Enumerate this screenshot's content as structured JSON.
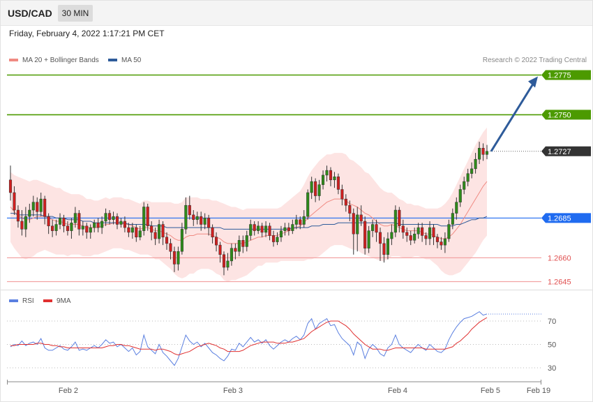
{
  "header": {
    "symbol": "USD/CAD",
    "timeframe": "30 MIN"
  },
  "datetime": "Friday, February 4, 2022 1:17:21 PM CET",
  "legend": {
    "ma20": {
      "label": "MA 20 + Bollinger Bands",
      "color": "#f08a82"
    },
    "ma50": {
      "label": "MA 50",
      "color": "#2e5b9a"
    }
  },
  "credit": "Research © 2022 Trading Central",
  "rsi_legend": {
    "rsi": {
      "label": "RSI",
      "color": "#5a7fe0"
    },
    "ma9": {
      "label": "9MA",
      "color": "#e03030"
    }
  },
  "chart_data": {
    "type": "candlestick",
    "x_labels": [
      "Feb 2",
      "Feb 3",
      "Feb 4",
      "Feb 5",
      "Feb 19"
    ],
    "y_range": [
      1.2628,
      1.2795
    ],
    "current_price": {
      "value": "1.2727",
      "color": "#333333"
    },
    "targets": [
      {
        "value": "1.2775",
        "color": "#4c9a00"
      },
      {
        "value": "1.2750",
        "color": "#4c9a00"
      }
    ],
    "pivot": {
      "value": "1.2685",
      "color": "#1f6bf0"
    },
    "supports": [
      {
        "value": "1.2660",
        "color": "#e05050"
      },
      {
        "value": "1.2645",
        "color": "#e05050"
      }
    ],
    "projection": {
      "from": 1.2727,
      "to": 1.2775,
      "color": "#2e5b9a"
    },
    "candles": [
      [
        1.2709,
        1.2701,
        1.2718,
        1.2696
      ],
      [
        1.2701,
        1.269,
        1.2705,
        1.2687
      ],
      [
        1.269,
        1.2683,
        1.2693,
        1.2679
      ],
      [
        1.2683,
        1.2678,
        1.269,
        1.2674
      ],
      [
        1.2678,
        1.2686,
        1.2692,
        1.2673
      ],
      [
        1.2686,
        1.269,
        1.2694,
        1.2682
      ],
      [
        1.269,
        1.2695,
        1.2699,
        1.2686
      ],
      [
        1.2695,
        1.2689,
        1.2698,
        1.2684
      ],
      [
        1.2689,
        1.2697,
        1.2701,
        1.2686
      ],
      [
        1.2697,
        1.2686,
        1.2699,
        1.2681
      ],
      [
        1.2686,
        1.268,
        1.2688,
        1.2675
      ],
      [
        1.268,
        1.2677,
        1.2684,
        1.2673
      ],
      [
        1.2677,
        1.2681,
        1.2684,
        1.2674
      ],
      [
        1.2681,
        1.2685,
        1.2688,
        1.2678
      ],
      [
        1.2685,
        1.268,
        1.2687,
        1.2676
      ],
      [
        1.268,
        1.2677,
        1.2683,
        1.2674
      ],
      [
        1.2677,
        1.2682,
        1.2685,
        1.2672
      ],
      [
        1.2682,
        1.2688,
        1.2692,
        1.2679
      ],
      [
        1.2688,
        1.2678,
        1.269,
        1.2674
      ],
      [
        1.2678,
        1.268,
        1.2683,
        1.2674
      ],
      [
        1.268,
        1.2676,
        1.2682,
        1.2672
      ],
      [
        1.2676,
        1.2679,
        1.2681,
        1.2672
      ],
      [
        1.2679,
        1.2682,
        1.2684,
        1.2676
      ],
      [
        1.2682,
        1.2679,
        1.2685,
        1.2676
      ],
      [
        1.2679,
        1.2683,
        1.2686,
        1.2675
      ],
      [
        1.2683,
        1.2688,
        1.2691,
        1.268
      ],
      [
        1.2688,
        1.2684,
        1.269,
        1.2681
      ],
      [
        1.2684,
        1.2686,
        1.2689,
        1.2681
      ],
      [
        1.2686,
        1.2681,
        1.2688,
        1.2678
      ],
      [
        1.2681,
        1.2683,
        1.2685,
        1.2679
      ],
      [
        1.2683,
        1.2679,
        1.2686,
        1.2676
      ],
      [
        1.2679,
        1.2676,
        1.2682,
        1.2673
      ],
      [
        1.2676,
        1.2679,
        1.2682,
        1.2672
      ],
      [
        1.2679,
        1.2673,
        1.2681,
        1.267
      ],
      [
        1.2673,
        1.2677,
        1.268,
        1.2671
      ],
      [
        1.2677,
        1.2692,
        1.2695,
        1.2674
      ],
      [
        1.2692,
        1.268,
        1.2694,
        1.2677
      ],
      [
        1.268,
        1.2676,
        1.2683,
        1.2671
      ],
      [
        1.2676,
        1.2672,
        1.2679,
        1.2668
      ],
      [
        1.2672,
        1.2681,
        1.2684,
        1.2669
      ],
      [
        1.2681,
        1.2673,
        1.2683,
        1.2668
      ],
      [
        1.2673,
        1.2669,
        1.2676,
        1.2665
      ],
      [
        1.2669,
        1.2664,
        1.2672,
        1.2659
      ],
      [
        1.2664,
        1.2656,
        1.2667,
        1.2651
      ],
      [
        1.2656,
        1.2664,
        1.2667,
        1.2652
      ],
      [
        1.2664,
        1.2678,
        1.2682,
        1.2662
      ],
      [
        1.2678,
        1.2693,
        1.2698,
        1.2675
      ],
      [
        1.2693,
        1.2687,
        1.2699,
        1.2684
      ],
      [
        1.2687,
        1.2684,
        1.269,
        1.268
      ],
      [
        1.2684,
        1.2686,
        1.2689,
        1.2681
      ],
      [
        1.2686,
        1.2681,
        1.2689,
        1.2677
      ],
      [
        1.2681,
        1.2685,
        1.2688,
        1.2678
      ],
      [
        1.2685,
        1.2679,
        1.2687,
        1.2674
      ],
      [
        1.2679,
        1.2673,
        1.2681,
        1.2669
      ],
      [
        1.2673,
        1.2668,
        1.2676,
        1.2664
      ],
      [
        1.2668,
        1.2662,
        1.267,
        1.2657
      ],
      [
        1.2662,
        1.2654,
        1.2664,
        1.2649
      ],
      [
        1.2654,
        1.2658,
        1.2663,
        1.2652
      ],
      [
        1.2658,
        1.2666,
        1.2669,
        1.2655
      ],
      [
        1.2666,
        1.2664,
        1.2669,
        1.2659
      ],
      [
        1.2664,
        1.2671,
        1.2674,
        1.2661
      ],
      [
        1.2671,
        1.2667,
        1.2674,
        1.2663
      ],
      [
        1.2667,
        1.2674,
        1.2677,
        1.2664
      ],
      [
        1.2674,
        1.2681,
        1.2684,
        1.2671
      ],
      [
        1.2681,
        1.2677,
        1.2683,
        1.2674
      ],
      [
        1.2677,
        1.268,
        1.2683,
        1.2675
      ],
      [
        1.268,
        1.2676,
        1.2682,
        1.2673
      ],
      [
        1.2676,
        1.268,
        1.2683,
        1.2673
      ],
      [
        1.268,
        1.2674,
        1.2682,
        1.2671
      ],
      [
        1.2674,
        1.267,
        1.2677,
        1.2667
      ],
      [
        1.267,
        1.2673,
        1.2676,
        1.2668
      ],
      [
        1.2673,
        1.2677,
        1.268,
        1.267
      ],
      [
        1.2677,
        1.2679,
        1.2682,
        1.2674
      ],
      [
        1.2679,
        1.2677,
        1.2682,
        1.2674
      ],
      [
        1.2677,
        1.2681,
        1.2684,
        1.2675
      ],
      [
        1.2681,
        1.2684,
        1.2687,
        1.2678
      ],
      [
        1.2684,
        1.2681,
        1.2686,
        1.2678
      ],
      [
        1.2681,
        1.2686,
        1.269,
        1.2679
      ],
      [
        1.2686,
        1.2701,
        1.2703,
        1.2684
      ],
      [
        1.2701,
        1.2708,
        1.2711,
        1.2697
      ],
      [
        1.2708,
        1.2699,
        1.271,
        1.2695
      ],
      [
        1.2699,
        1.2706,
        1.2709,
        1.2696
      ],
      [
        1.2706,
        1.2712,
        1.2715,
        1.2703
      ],
      [
        1.2712,
        1.2715,
        1.2718,
        1.2708
      ],
      [
        1.2715,
        1.2709,
        1.2717,
        1.2705
      ],
      [
        1.2709,
        1.2711,
        1.2714,
        1.2704
      ],
      [
        1.2711,
        1.2703,
        1.2713,
        1.27
      ],
      [
        1.2703,
        1.2697,
        1.2706,
        1.2693
      ],
      [
        1.2697,
        1.2693,
        1.27,
        1.2689
      ],
      [
        1.2693,
        1.2688,
        1.2696,
        1.2683
      ],
      [
        1.2688,
        1.2675,
        1.2691,
        1.2662
      ],
      [
        1.2675,
        1.2687,
        1.2692,
        1.2664
      ],
      [
        1.2687,
        1.2683,
        1.2693,
        1.268
      ],
      [
        1.2683,
        1.2666,
        1.2686,
        1.2662
      ],
      [
        1.2666,
        1.2677,
        1.268,
        1.2663
      ],
      [
        1.2677,
        1.2681,
        1.2684,
        1.2673
      ],
      [
        1.2681,
        1.2676,
        1.2684,
        1.267
      ],
      [
        1.2676,
        1.2669,
        1.2679,
        1.2658
      ],
      [
        1.2669,
        1.2662,
        1.2673,
        1.2657
      ],
      [
        1.2662,
        1.2672,
        1.2676,
        1.2659
      ],
      [
        1.2672,
        1.2676,
        1.2681,
        1.2668
      ],
      [
        1.2676,
        1.269,
        1.2693,
        1.2673
      ],
      [
        1.269,
        1.268,
        1.2692,
        1.2676
      ],
      [
        1.268,
        1.2676,
        1.2684,
        1.2672
      ],
      [
        1.2676,
        1.2674,
        1.2679,
        1.267
      ],
      [
        1.2674,
        1.2671,
        1.2677,
        1.2668
      ],
      [
        1.2671,
        1.2675,
        1.2679,
        1.2669
      ],
      [
        1.2675,
        1.2679,
        1.2682,
        1.2672
      ],
      [
        1.2679,
        1.2674,
        1.2682,
        1.267
      ],
      [
        1.2674,
        1.2672,
        1.2676,
        1.2668
      ],
      [
        1.2672,
        1.2679,
        1.2683,
        1.2668
      ],
      [
        1.2679,
        1.2673,
        1.2681,
        1.2668
      ],
      [
        1.2673,
        1.267,
        1.2675,
        1.2666
      ],
      [
        1.267,
        1.2668,
        1.2673,
        1.2665
      ],
      [
        1.2668,
        1.2672,
        1.2676,
        1.2663
      ],
      [
        1.2672,
        1.2681,
        1.2684,
        1.267
      ],
      [
        1.2681,
        1.2688,
        1.2691,
        1.2678
      ],
      [
        1.2688,
        1.2695,
        1.2698,
        1.2684
      ],
      [
        1.2695,
        1.2703,
        1.2706,
        1.2692
      ],
      [
        1.2703,
        1.2708,
        1.2711,
        1.27
      ],
      [
        1.2708,
        1.2713,
        1.2716,
        1.2705
      ],
      [
        1.2713,
        1.2716,
        1.272,
        1.271
      ],
      [
        1.2716,
        1.2722,
        1.2726,
        1.2713
      ],
      [
        1.2722,
        1.2729,
        1.2733,
        1.2719
      ],
      [
        1.2729,
        1.2725,
        1.2732,
        1.2721
      ],
      [
        1.2725,
        1.2727,
        1.2731,
        1.2722
      ]
    ],
    "ma20": [
      1.2692,
      1.2689,
      1.2687,
      1.2685,
      1.2684,
      1.2684,
      1.2685,
      1.2686,
      1.2686,
      1.2686,
      1.2685,
      1.2684,
      1.2683,
      1.2683,
      1.2682,
      1.2681,
      1.2681,
      1.2681,
      1.2681,
      1.268,
      1.2679,
      1.2679,
      1.2679,
      1.2679,
      1.268,
      1.2681,
      1.2681,
      1.2682,
      1.2682,
      1.2682,
      1.2681,
      1.2681,
      1.268,
      1.2679,
      1.2678,
      1.2679,
      1.2679,
      1.2678,
      1.2677,
      1.2677,
      1.2676,
      1.2675,
      1.2674,
      1.2672,
      1.2671,
      1.2671,
      1.2673,
      1.2674,
      1.2674,
      1.2675,
      1.2675,
      1.2675,
      1.2675,
      1.2674,
      1.2673,
      1.2672,
      1.267,
      1.2669,
      1.2669,
      1.2669,
      1.2669,
      1.2669,
      1.267,
      1.2671,
      1.2672,
      1.2673,
      1.2673,
      1.2674,
      1.2674,
      1.2674,
      1.2674,
      1.2675,
      1.2676,
      1.2677,
      1.2678,
      1.2679,
      1.268,
      1.2682,
      1.2685,
      1.2687,
      1.2689,
      1.2691,
      1.2693,
      1.2695,
      1.2696,
      1.2697,
      1.2697,
      1.2697,
      1.2696,
      1.2694,
      1.2693,
      1.2692,
      1.269,
      1.2688,
      1.2687,
      1.2685,
      1.2683,
      1.2681,
      1.268,
      1.268,
      1.2681,
      1.268,
      1.2679,
      1.2678,
      1.2677,
      1.2677,
      1.2677,
      1.2677,
      1.2676,
      1.2675,
      1.2675,
      1.2674,
      1.2673,
      1.2672,
      1.2672,
      1.2673,
      1.2675,
      1.2678,
      1.2681,
      1.2685,
      1.2689,
      1.2693,
      1.2697,
      1.2701,
      1.2705,
      1.2708
    ],
    "ma50": [
      1.2688,
      1.2688,
      1.2687,
      1.2687,
      1.2687,
      1.2687,
      1.2687,
      1.2687,
      1.2687,
      1.2686,
      1.2686,
      1.2686,
      1.2685,
      1.2685,
      1.2685,
      1.2684,
      1.2684,
      1.2684,
      1.2684,
      1.2683,
      1.2683,
      1.2683,
      1.2682,
      1.2682,
      1.2682,
      1.2682,
      1.2682,
      1.2682,
      1.2682,
      1.2682,
      1.2682,
      1.2681,
      1.2681,
      1.2681,
      1.2681,
      1.2681,
      1.2681,
      1.268,
      1.268,
      1.268,
      1.268,
      1.2679,
      1.2679,
      1.2679,
      1.2679,
      1.2679,
      1.2679,
      1.2679,
      1.2679,
      1.2679,
      1.2679,
      1.2679,
      1.2679,
      1.2679,
      1.2679,
      1.2679,
      1.2678,
      1.2678,
      1.2678,
      1.2678,
      1.2678,
      1.2678,
      1.2678,
      1.2678,
      1.2678,
      1.2678,
      1.2678,
      1.2678,
      1.2678,
      1.2678,
      1.2678,
      1.2678,
      1.2678,
      1.2678,
      1.2679,
      1.2679,
      1.2679,
      1.2679,
      1.2679,
      1.268,
      1.268,
      1.268,
      1.2681,
      1.2681,
      1.2681,
      1.2681,
      1.2682,
      1.2682,
      1.2682,
      1.2682,
      1.2682,
      1.2682,
      1.2682,
      1.2682,
      1.2682,
      1.2682,
      1.2682,
      1.2682,
      1.2682,
      1.2682,
      1.2682,
      1.2682,
      1.2681,
      1.2681,
      1.2681,
      1.2681,
      1.2681,
      1.2681,
      1.2681,
      1.2681,
      1.2681,
      1.2681,
      1.2681,
      1.268,
      1.268,
      1.268,
      1.268,
      1.2681,
      1.2681,
      1.2682,
      1.2683,
      1.2684,
      1.2684,
      1.2685,
      1.2685,
      1.2686
    ],
    "band_width": [
      0.0022,
      0.0023,
      0.0024,
      0.0025,
      0.0025,
      0.0024,
      0.0024,
      0.0023,
      0.0022,
      0.0021,
      0.0021,
      0.0021,
      0.0021,
      0.0021,
      0.002,
      0.002,
      0.0019,
      0.0019,
      0.0019,
      0.0019,
      0.0018,
      0.0018,
      0.0017,
      0.0017,
      0.0017,
      0.0017,
      0.0016,
      0.0016,
      0.0016,
      0.0016,
      0.0016,
      0.0016,
      0.0016,
      0.0016,
      0.0016,
      0.0017,
      0.0017,
      0.0017,
      0.0018,
      0.0018,
      0.0019,
      0.002,
      0.0021,
      0.0022,
      0.0023,
      0.0024,
      0.0025,
      0.0024,
      0.0024,
      0.0023,
      0.0022,
      0.0022,
      0.0022,
      0.0022,
      0.0023,
      0.0023,
      0.0024,
      0.0024,
      0.0023,
      0.0023,
      0.0022,
      0.0021,
      0.0021,
      0.002,
      0.0019,
      0.0018,
      0.0018,
      0.0017,
      0.0017,
      0.0017,
      0.0017,
      0.0017,
      0.0018,
      0.0019,
      0.002,
      0.0021,
      0.0022,
      0.0024,
      0.0026,
      0.0028,
      0.0029,
      0.003,
      0.003,
      0.003,
      0.0029,
      0.0029,
      0.0029,
      0.0029,
      0.0029,
      0.0028,
      0.0028,
      0.0027,
      0.0027,
      0.0026,
      0.0026,
      0.0025,
      0.0024,
      0.0023,
      0.0022,
      0.0021,
      0.002,
      0.0019,
      0.0018,
      0.0018,
      0.0017,
      0.0017,
      0.0016,
      0.0016,
      0.0016,
      0.0016,
      0.0016,
      0.0017,
      0.0018,
      0.002,
      0.0022,
      0.0024,
      0.0026,
      0.0028,
      0.003,
      0.0031,
      0.0032,
      0.0033,
      0.0034,
      0.0034,
      0.0034,
      0.0034,
      0.0033
    ],
    "rsi": {
      "y_range": [
        20,
        80
      ],
      "ticks": [
        "70",
        "50",
        "30"
      ],
      "rsi_values": [
        48,
        50,
        49,
        53,
        49,
        51,
        52,
        50,
        55,
        47,
        45,
        45,
        47,
        49,
        46,
        45,
        48,
        52,
        45,
        46,
        45,
        47,
        49,
        47,
        50,
        54,
        51,
        52,
        48,
        50,
        47,
        44,
        47,
        41,
        44,
        58,
        48,
        45,
        42,
        50,
        43,
        40,
        36,
        32,
        38,
        48,
        58,
        53,
        50,
        52,
        48,
        51,
        47,
        43,
        41,
        38,
        36,
        40,
        46,
        45,
        51,
        48,
        52,
        56,
        52,
        54,
        51,
        54,
        49,
        46,
        49,
        52,
        54,
        52,
        55,
        57,
        54,
        58,
        68,
        72,
        63,
        68,
        70,
        72,
        66,
        67,
        60,
        55,
        52,
        49,
        41,
        52,
        49,
        38,
        46,
        50,
        47,
        42,
        40,
        47,
        50,
        58,
        50,
        47,
        45,
        43,
        47,
        50,
        47,
        45,
        50,
        47,
        44,
        43,
        46,
        54,
        60,
        65,
        69,
        72,
        73,
        74,
        76,
        78,
        75,
        76
      ],
      "ma9_values": [
        49,
        49,
        50,
        50,
        50,
        50,
        50,
        51,
        51,
        50,
        50,
        49,
        49,
        48,
        48,
        47,
        47,
        47,
        47,
        47,
        47,
        47,
        47,
        47,
        47,
        48,
        49,
        49,
        50,
        50,
        49,
        49,
        48,
        47,
        46,
        46,
        46,
        46,
        45,
        46,
        46,
        45,
        44,
        42,
        41,
        42,
        43,
        44,
        46,
        48,
        49,
        50,
        51,
        50,
        49,
        47,
        46,
        44,
        44,
        44,
        44,
        45,
        47,
        49,
        50,
        51,
        52,
        52,
        52,
        52,
        51,
        51,
        51,
        52,
        52,
        53,
        54,
        55,
        58,
        61,
        63,
        65,
        67,
        69,
        70,
        70,
        70,
        68,
        66,
        63,
        59,
        56,
        53,
        50,
        48,
        46,
        46,
        46,
        45,
        45,
        46,
        47,
        47,
        47,
        47,
        47,
        47,
        47,
        47,
        46,
        46,
        46,
        46,
        46,
        46,
        47,
        48,
        51,
        53,
        56,
        59,
        63,
        66,
        69,
        71,
        73
      ]
    }
  }
}
